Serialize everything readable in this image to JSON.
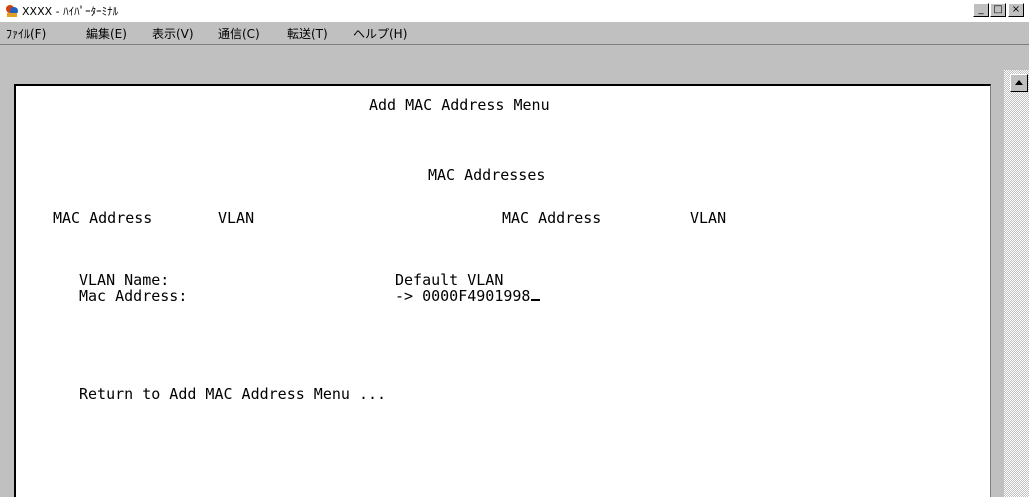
{
  "window": {
    "title": "XXXX - ﾊｲﾊﾟｰﾀｰﾐﾅﾙ",
    "controls": {
      "minimize": "_",
      "maximize": "□",
      "close": "×"
    }
  },
  "menu": [
    {
      "label": "ﾌｧｲﾙ(F)"
    },
    {
      "label": "編集(E)"
    },
    {
      "label": "表示(V)"
    },
    {
      "label": "通信(C)"
    },
    {
      "label": "転送(T)"
    },
    {
      "label": "ヘルプ(H)"
    }
  ],
  "terminal": {
    "heading": "Add MAC Address Menu",
    "subheading": "MAC Addresses",
    "col_mac_left": "MAC Address",
    "col_vlan_left": "VLAN",
    "col_mac_right": "MAC Address",
    "col_vlan_right": "VLAN",
    "vlan_name_label": "VLAN Name:",
    "vlan_name_value": "Default VLAN",
    "mac_label": "Mac Address:",
    "mac_value": "-> 0000F4901998",
    "return_text": "Return to Add MAC Address Menu ..."
  },
  "icons": {
    "app": "hyperterminal-icon",
    "scroll_up": "scroll-up-arrow-icon"
  }
}
